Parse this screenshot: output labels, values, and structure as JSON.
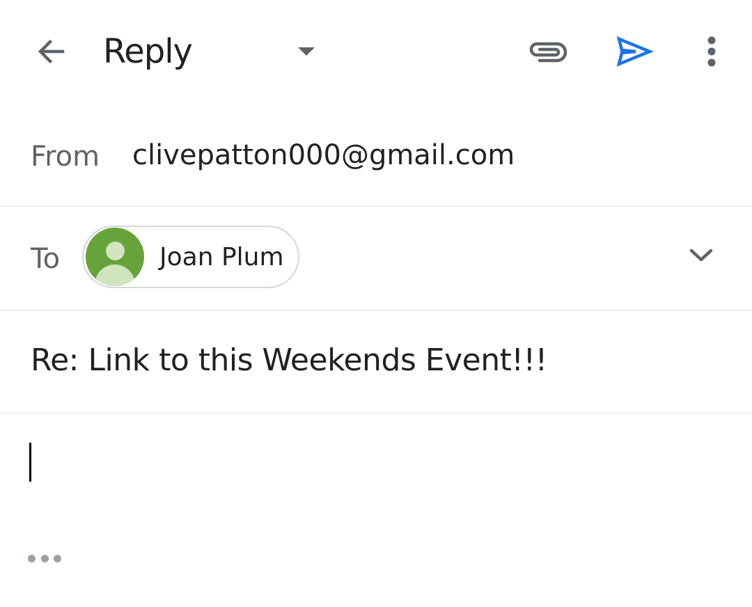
{
  "toolbar": {
    "back_icon": "arrow-back-icon",
    "mode_title": "Reply",
    "mode_dropdown_icon": "caret-down-icon",
    "attach_icon": "paperclip-icon",
    "send_icon": "send-icon",
    "more_icon": "more-vert-icon",
    "send_color": "#1a73e8"
  },
  "from": {
    "label": "From",
    "value": "clivepatton000@gmail.com"
  },
  "to": {
    "label": "To",
    "recipients": [
      {
        "name": "Joan Plum",
        "avatar_color": "#67a33b"
      }
    ],
    "expand_icon": "chevron-down-icon"
  },
  "subject": {
    "value": "Re: Link to this Weekends Event!!!"
  },
  "body": {
    "value": "",
    "show_quoted_icon": "more-horiz-icon"
  }
}
